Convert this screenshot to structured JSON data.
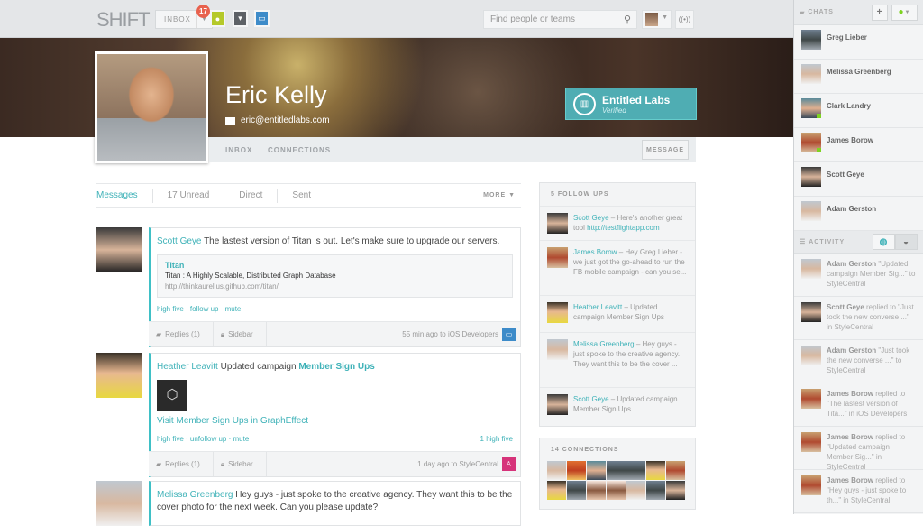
{
  "topbar": {
    "logo": "SHIFT",
    "inbox_label": "INBOX",
    "unread_badge": "17",
    "search_placeholder": "Find people or teams"
  },
  "profile": {
    "name": "Eric Kelly",
    "email": "eric@entitledlabs.com",
    "company": "Entitled Labs",
    "company_status": "Verified",
    "tabs": [
      "INBOX",
      "CONNECTIONS"
    ],
    "message_button": "MESSAGE"
  },
  "message_tabs": [
    "Messages",
    "17 Unread",
    "Direct",
    "Sent"
  ],
  "more_label": "MORE",
  "feed": [
    {
      "author": "Scott Geye",
      "text": "The lastest version of Titan is out. Let's make sure to upgrade our servers.",
      "link_title": "Titan",
      "link_desc": "Titan : A Highly Scalable, Distributed Graph Database",
      "link_url": "http://thinkaurelius.github.com/titan/",
      "actions": [
        "high five",
        "follow up",
        "mute"
      ],
      "replies": "Replies (1)",
      "sidebar": "Sidebar",
      "time": "55 min ago to iOS Developers",
      "group_color": "#3d8bc9"
    },
    {
      "author": "Heather Leavitt",
      "text": "Updated campaign",
      "campaign": "Member Sign Ups",
      "visit": "Visit Member Sign Ups in GraphEffect",
      "actions": [
        "high five",
        "unfollow up",
        "mute"
      ],
      "high_fives": "1 high five",
      "replies": "Replies (1)",
      "sidebar": "Sidebar",
      "time": "1 day ago to StyleCentral",
      "group_color": "#d6337a"
    },
    {
      "author": "Melissa Greenberg",
      "text": "Hey guys - just spoke to the creative agency. They want this to be the cover photo for the next week. Can you please update?"
    }
  ],
  "follow_ups": {
    "title": "5 FOLLOW UPS",
    "items": [
      {
        "name": "Scott Geye",
        "text": " – Here's another great tool ",
        "link": "http://testflightapp.com"
      },
      {
        "name": "James Borow",
        "text": " – Hey Greg Lieber - we just got the go-ahead to run the FB mobile campaign - can you se..."
      },
      {
        "name": "Heather Leavitt",
        "text": " – Updated campaign Member Sign Ups"
      },
      {
        "name": "Melissa Greenberg",
        "text": " – Hey guys - just spoke to the creative agency. They want this to be the cover ..."
      },
      {
        "name": "Scott Geye",
        "text": " – Updated campaign Member Sign Ups"
      }
    ]
  },
  "connections": {
    "title": "14 CONNECTIONS",
    "count": 14
  },
  "chats": {
    "title": "CHATS",
    "items": [
      {
        "name": "Greg Lieber",
        "online": false
      },
      {
        "name": "Melissa Greenberg",
        "online": false
      },
      {
        "name": "Clark Landry",
        "online": true
      },
      {
        "name": "James Borow",
        "online": true
      },
      {
        "name": "Scott Geye",
        "online": false
      },
      {
        "name": "Adam Gerston",
        "online": false
      }
    ]
  },
  "activity": {
    "title": "ACTIVITY",
    "items": [
      {
        "name": "Adam Gerston",
        "text": " \"Updated campaign Member Sig...\" to StyleCentral"
      },
      {
        "name": "Scott Geye",
        "text": " replied to \"Just took the new converse ...\" in StyleCentral"
      },
      {
        "name": "Adam Gerston",
        "text": " \"Just took the new converse ...\" to StyleCentral"
      },
      {
        "name": "James Borow",
        "text": " replied to \"The lastest version of Tita...\" in iOS Developers"
      },
      {
        "name": "James Borow",
        "text": " replied to \"Updated campaign Member Sig...\" in StyleCentral"
      },
      {
        "name": "James Borow",
        "text": " replied to \"Hey guys - just spoke to th...\" in StyleCentral"
      }
    ]
  }
}
